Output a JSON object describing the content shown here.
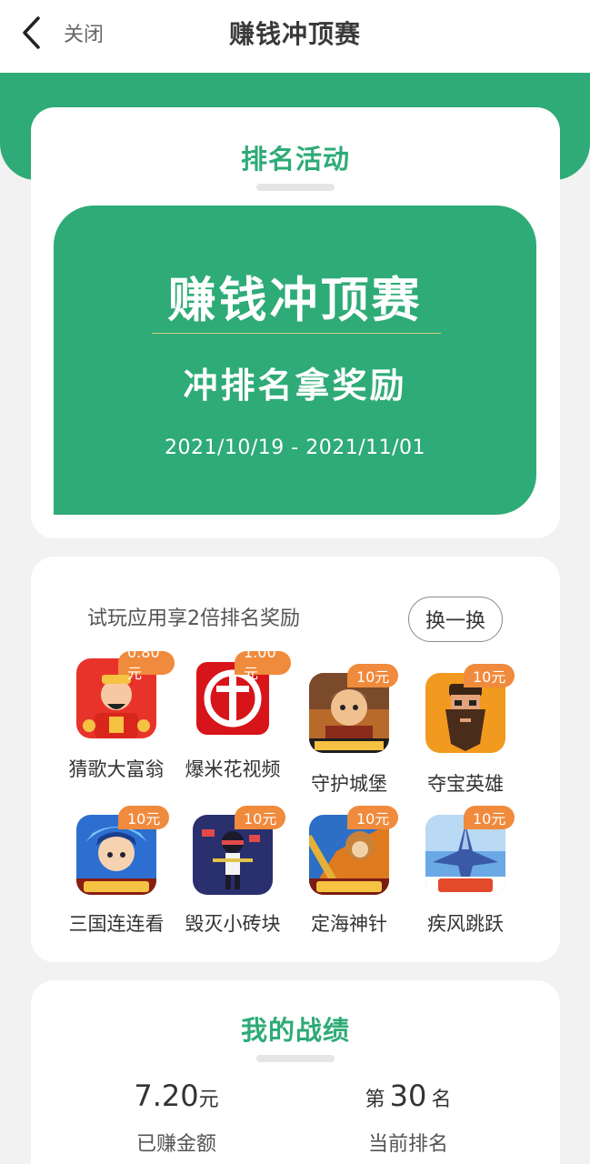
{
  "nav": {
    "back_label": "关闭",
    "title": "赚钱冲顶赛"
  },
  "colors": {
    "primary_green": "#2eab76",
    "badge_orange": "#f08a3c"
  },
  "activity": {
    "section_title": "排名活动",
    "hero_title": "赚钱冲顶赛",
    "hero_subtitle": "冲排名拿奖励",
    "date_range": "2021/10/19 - 2021/11/01"
  },
  "apps_section": {
    "tip": "试玩应用享2倍排名奖励",
    "swap_label": "换一换",
    "apps": [
      {
        "name": "猜歌大富翁",
        "reward": "0.80元",
        "icon": "money-god-icon"
      },
      {
        "name": "爆米花视频",
        "reward": "1.00元",
        "icon": "citic-logo-icon"
      },
      {
        "name": "守护城堡",
        "reward": "10元",
        "icon": "castle-game-icon"
      },
      {
        "name": "夺宝英雄",
        "reward": "10元",
        "icon": "bearded-hero-icon"
      },
      {
        "name": "三国连连看",
        "reward": "10元",
        "icon": "three-kingdoms-icon"
      },
      {
        "name": "毁灭小砖块",
        "reward": "10元",
        "icon": "brick-ninja-icon"
      },
      {
        "name": "定海神针",
        "reward": "10元",
        "icon": "monkey-king-icon"
      },
      {
        "name": "疾风跳跃",
        "reward": "10元",
        "icon": "jet-fighter-icon"
      }
    ]
  },
  "my_record": {
    "section_title": "我的战绩",
    "earned_value": "7.20",
    "earned_unit": "元",
    "earned_label": "已赚金额",
    "rank_prefix": "第",
    "rank_value": "30",
    "rank_suffix": "名",
    "rank_label": "当前排名"
  }
}
